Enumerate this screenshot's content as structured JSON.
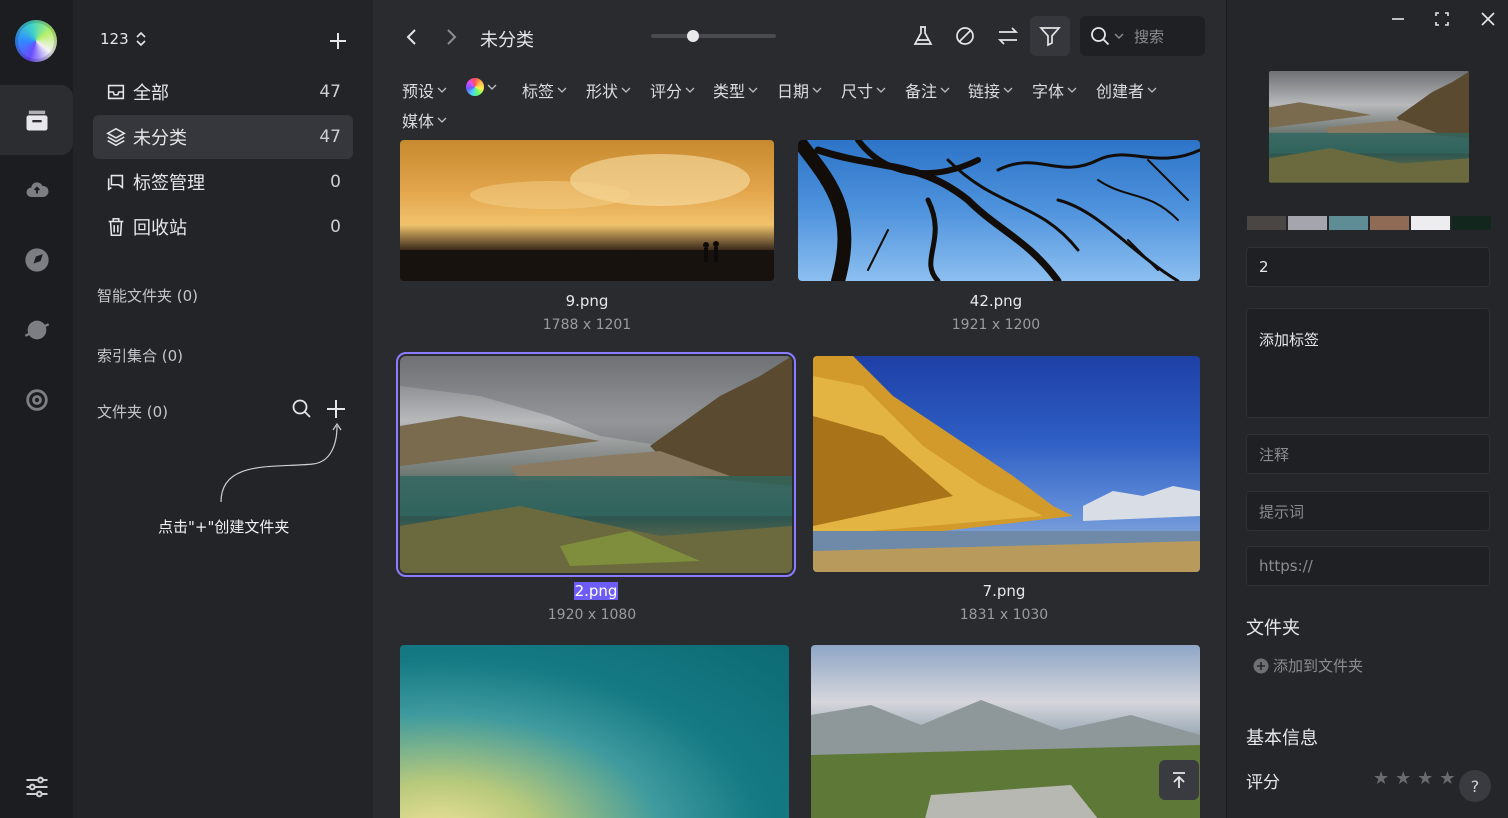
{
  "library": {
    "name": "123"
  },
  "nav": [
    {
      "label": "全部",
      "count": "47"
    },
    {
      "label": "未分类",
      "count": "47"
    },
    {
      "label": "标签管理",
      "count": "0"
    },
    {
      "label": "回收站",
      "count": "0"
    }
  ],
  "sections": {
    "smart": "智能文件夹 (0)",
    "index": "索引集合 (0)",
    "folders": "文件夹 (0)"
  },
  "hint": "点击\"+\"创建文件夹",
  "breadcrumb": "未分类",
  "search": {
    "placeholder": "搜索"
  },
  "filters": [
    "预设",
    "标签",
    "形状",
    "评分",
    "类型",
    "日期",
    "尺寸",
    "备注",
    "链接",
    "字体",
    "创建者",
    "媒体"
  ],
  "zoom_level": 0.33,
  "items": [
    {
      "name": "9.png",
      "dims": "1788 x 1201"
    },
    {
      "name": "42.png",
      "dims": "1921 x 1200"
    },
    {
      "name": "2.png",
      "dims": "1920 x 1080",
      "selected": true
    },
    {
      "name": "7.png",
      "dims": "1831 x 1030"
    }
  ],
  "inspector": {
    "palette": [
      "#4a4644",
      "#a5a6ad",
      "#5f8d95",
      "#8f6a55",
      "#ededf0",
      "#12261d"
    ],
    "name_value": "2",
    "tags_placeholder": "添加标签",
    "note_placeholder": "注释",
    "prompt_placeholder": "提示词",
    "url_placeholder": "https://",
    "folder_title": "文件夹",
    "add_folder": "添加到文件夹",
    "basic_title": "基本信息",
    "rating_label": "评分",
    "rating": 0,
    "help": "?"
  }
}
